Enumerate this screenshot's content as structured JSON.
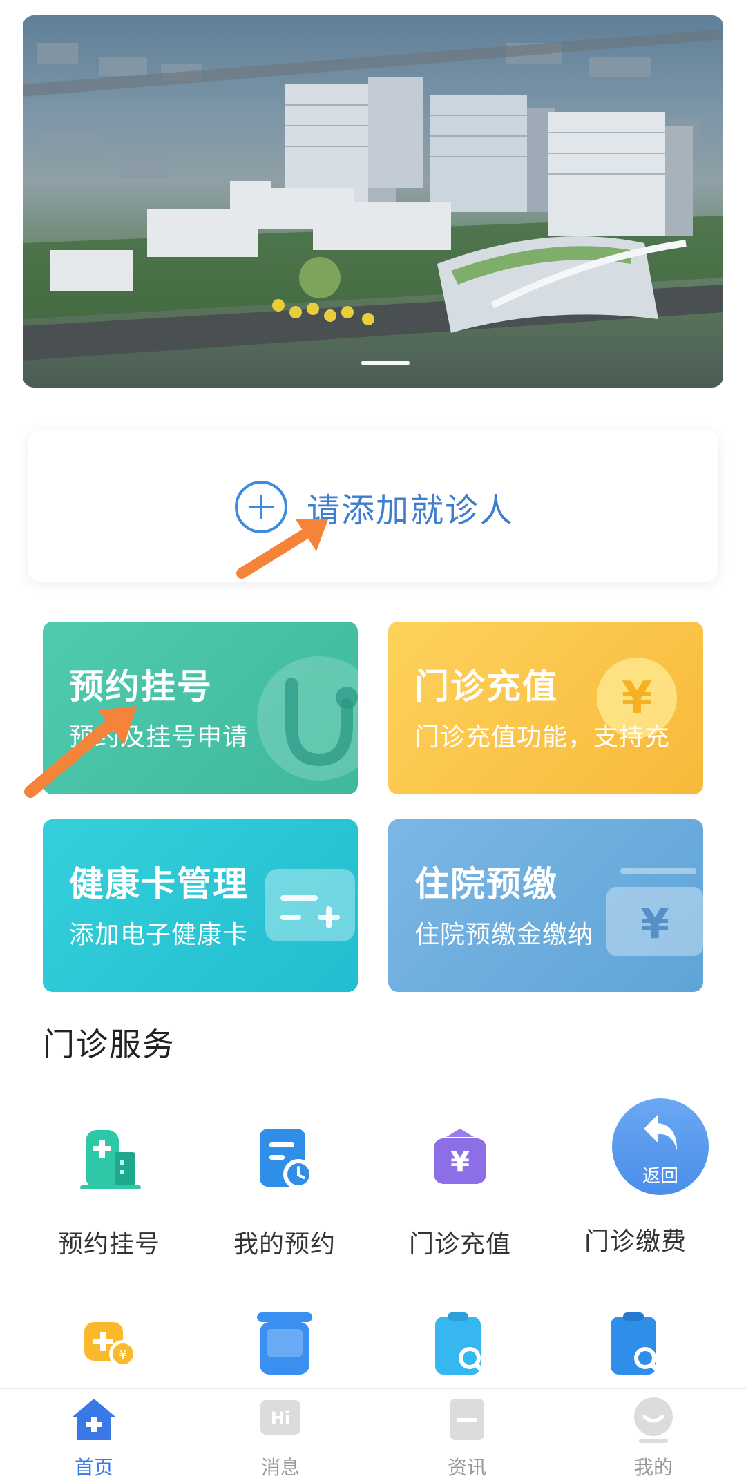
{
  "banner": {
    "image": "hospital-campus-aerial-photo"
  },
  "patient": {
    "add_label": "请添加就诊人"
  },
  "features": [
    {
      "title": "预约挂号",
      "subtitle": "预约及挂号申请",
      "icon": "stethoscope-icon",
      "color": "#46c2a6"
    },
    {
      "title": "门诊充值",
      "subtitle": "门诊充值功能，支持充",
      "icon": "yuan-coin-icon",
      "color": "#fbc54a"
    },
    {
      "title": "健康卡管理",
      "subtitle": "添加电子健康卡",
      "icon": "card-plus-icon",
      "color": "#2cc7d6"
    },
    {
      "title": "住院预缴",
      "subtitle": "住院预缴金缴纳",
      "icon": "yuan-wallet-icon",
      "color": "#6faede"
    }
  ],
  "section": {
    "title": "门诊服务"
  },
  "services": [
    {
      "label": "预约挂号",
      "icon": "hospital-building-icon"
    },
    {
      "label": "我的预约",
      "icon": "calendar-clock-icon"
    },
    {
      "label": "门诊充值",
      "icon": "yuan-bag-icon"
    },
    {
      "label": "门诊缴费",
      "icon": "payment-icon"
    }
  ],
  "services_row2": [
    {
      "icon": "medical-pay-icon"
    },
    {
      "icon": "queue-number-icon"
    },
    {
      "icon": "report-search-icon"
    },
    {
      "icon": "record-search-icon"
    }
  ],
  "back_button": {
    "label": "返回"
  },
  "tabs": [
    {
      "label": "首页",
      "icon": "home-icon",
      "active": true
    },
    {
      "label": "消息",
      "icon": "message-icon",
      "active": false
    },
    {
      "label": "资讯",
      "icon": "news-icon",
      "active": false
    },
    {
      "label": "我的",
      "icon": "profile-icon",
      "active": false
    }
  ],
  "colors": {
    "accent": "#3a78e6",
    "annotation_arrow": "#f5843a"
  }
}
